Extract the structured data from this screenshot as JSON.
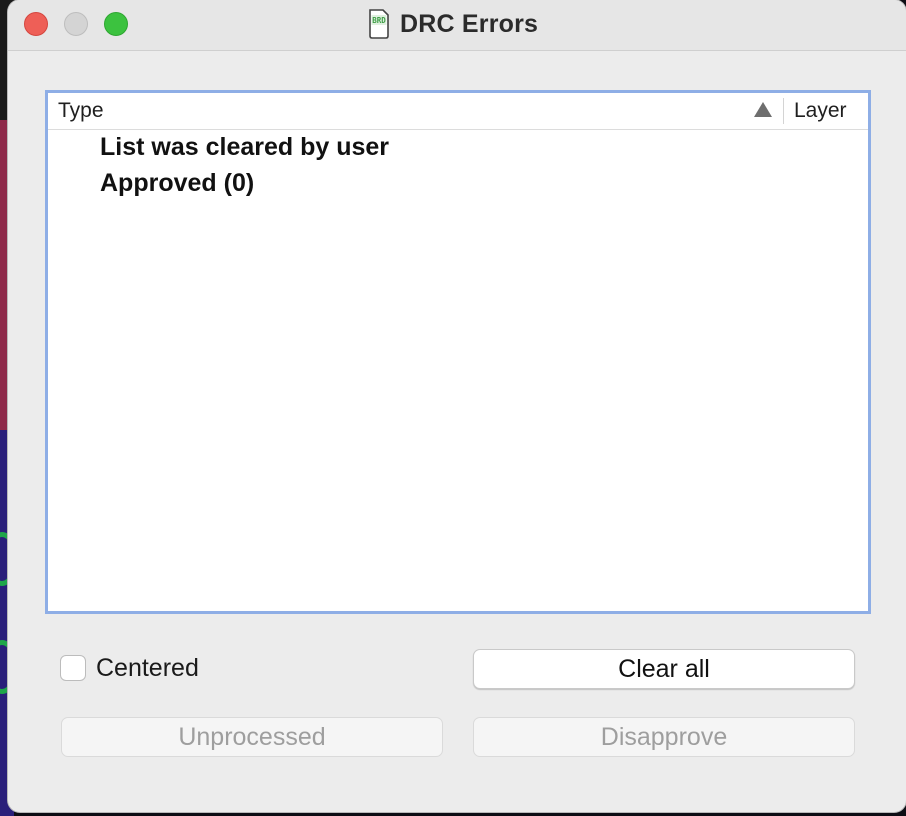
{
  "window": {
    "title": "DRC Errors",
    "icon": "brd-document-icon",
    "icon_text": "BRD"
  },
  "list": {
    "columns": [
      "Type",
      "Layer"
    ],
    "sort_icon": "sort-ascending-icon",
    "items": [
      "List was cleared by user",
      "Approved (0)"
    ]
  },
  "controls": {
    "centered_label": "Centered",
    "centered_checked": false,
    "clear_all_label": "Clear all",
    "unprocessed_label": "Unprocessed",
    "disapprove_label": "Disapprove"
  },
  "colors": {
    "list_focus_border": "#8eaee6",
    "close": "#ee5f57",
    "zoom": "#3cc23f"
  }
}
